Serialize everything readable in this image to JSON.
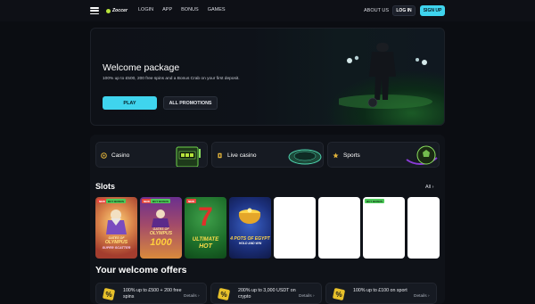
{
  "header": {
    "logo_text": "Zoccer",
    "nav": [
      "LOGIN",
      "APP",
      "BONUS",
      "GAMES"
    ],
    "about_label": "ABOUT US",
    "login_label": "LOG IN",
    "signup_label": "SIGN UP"
  },
  "hero": {
    "title": "Welcome package",
    "subtitle": "100% up to £500, 200 free spins and a Bonus Crab on your first deposit.",
    "play_label": "PLAY",
    "promos_label": "ALL PROMOTIONS"
  },
  "categories": [
    {
      "label": "Casino",
      "icon": "casino-icon"
    },
    {
      "label": "Live casino",
      "icon": "live-casino-icon"
    },
    {
      "label": "Sports",
      "icon": "sports-icon"
    }
  ],
  "slots": {
    "title": "Slots",
    "all_label": "All",
    "games": [
      {
        "badges": [
          "NEW",
          "BUY BONUS"
        ],
        "art": "GATES OF OLYMPUS SUPER SCATTER",
        "lines": [
          "GATES OF",
          "OLYMPUS",
          "SUPER SCATTER"
        ]
      },
      {
        "badges": [
          "NEW",
          "BUY BONUS"
        ],
        "art": "GATES OF OLYMPUS 1000",
        "lines": [
          "GATES OF",
          "OLYMPUS",
          "1000"
        ]
      },
      {
        "badges": [
          "NEW"
        ],
        "art": "ULTIMATE HOT",
        "lines": [
          "7",
          "ULTIMATE",
          "HOT"
        ]
      },
      {
        "badges": [],
        "art": "4 POTS OF EGYPT",
        "lines": [
          "4 POTS OF EGYPT",
          "HOLD AND WIN"
        ]
      },
      {
        "badges": [],
        "art": "",
        "lines": []
      },
      {
        "badges": [],
        "art": "",
        "lines": []
      },
      {
        "badges": [
          "BUY BONUS"
        ],
        "art": "",
        "lines": []
      },
      {
        "badges": [],
        "art": "",
        "lines": []
      }
    ]
  },
  "offers": {
    "title": "Your welcome offers",
    "details_label": "Details",
    "items": [
      {
        "text": "100% up to £500 + 200 free spins"
      },
      {
        "text": "200% up to 3,000 USDT on crypto"
      },
      {
        "text": "100% up to £100 on sport"
      }
    ]
  },
  "colors": {
    "accent": "#3fd4ee",
    "lime": "#b7e33c",
    "bg": "#0b0d12"
  }
}
